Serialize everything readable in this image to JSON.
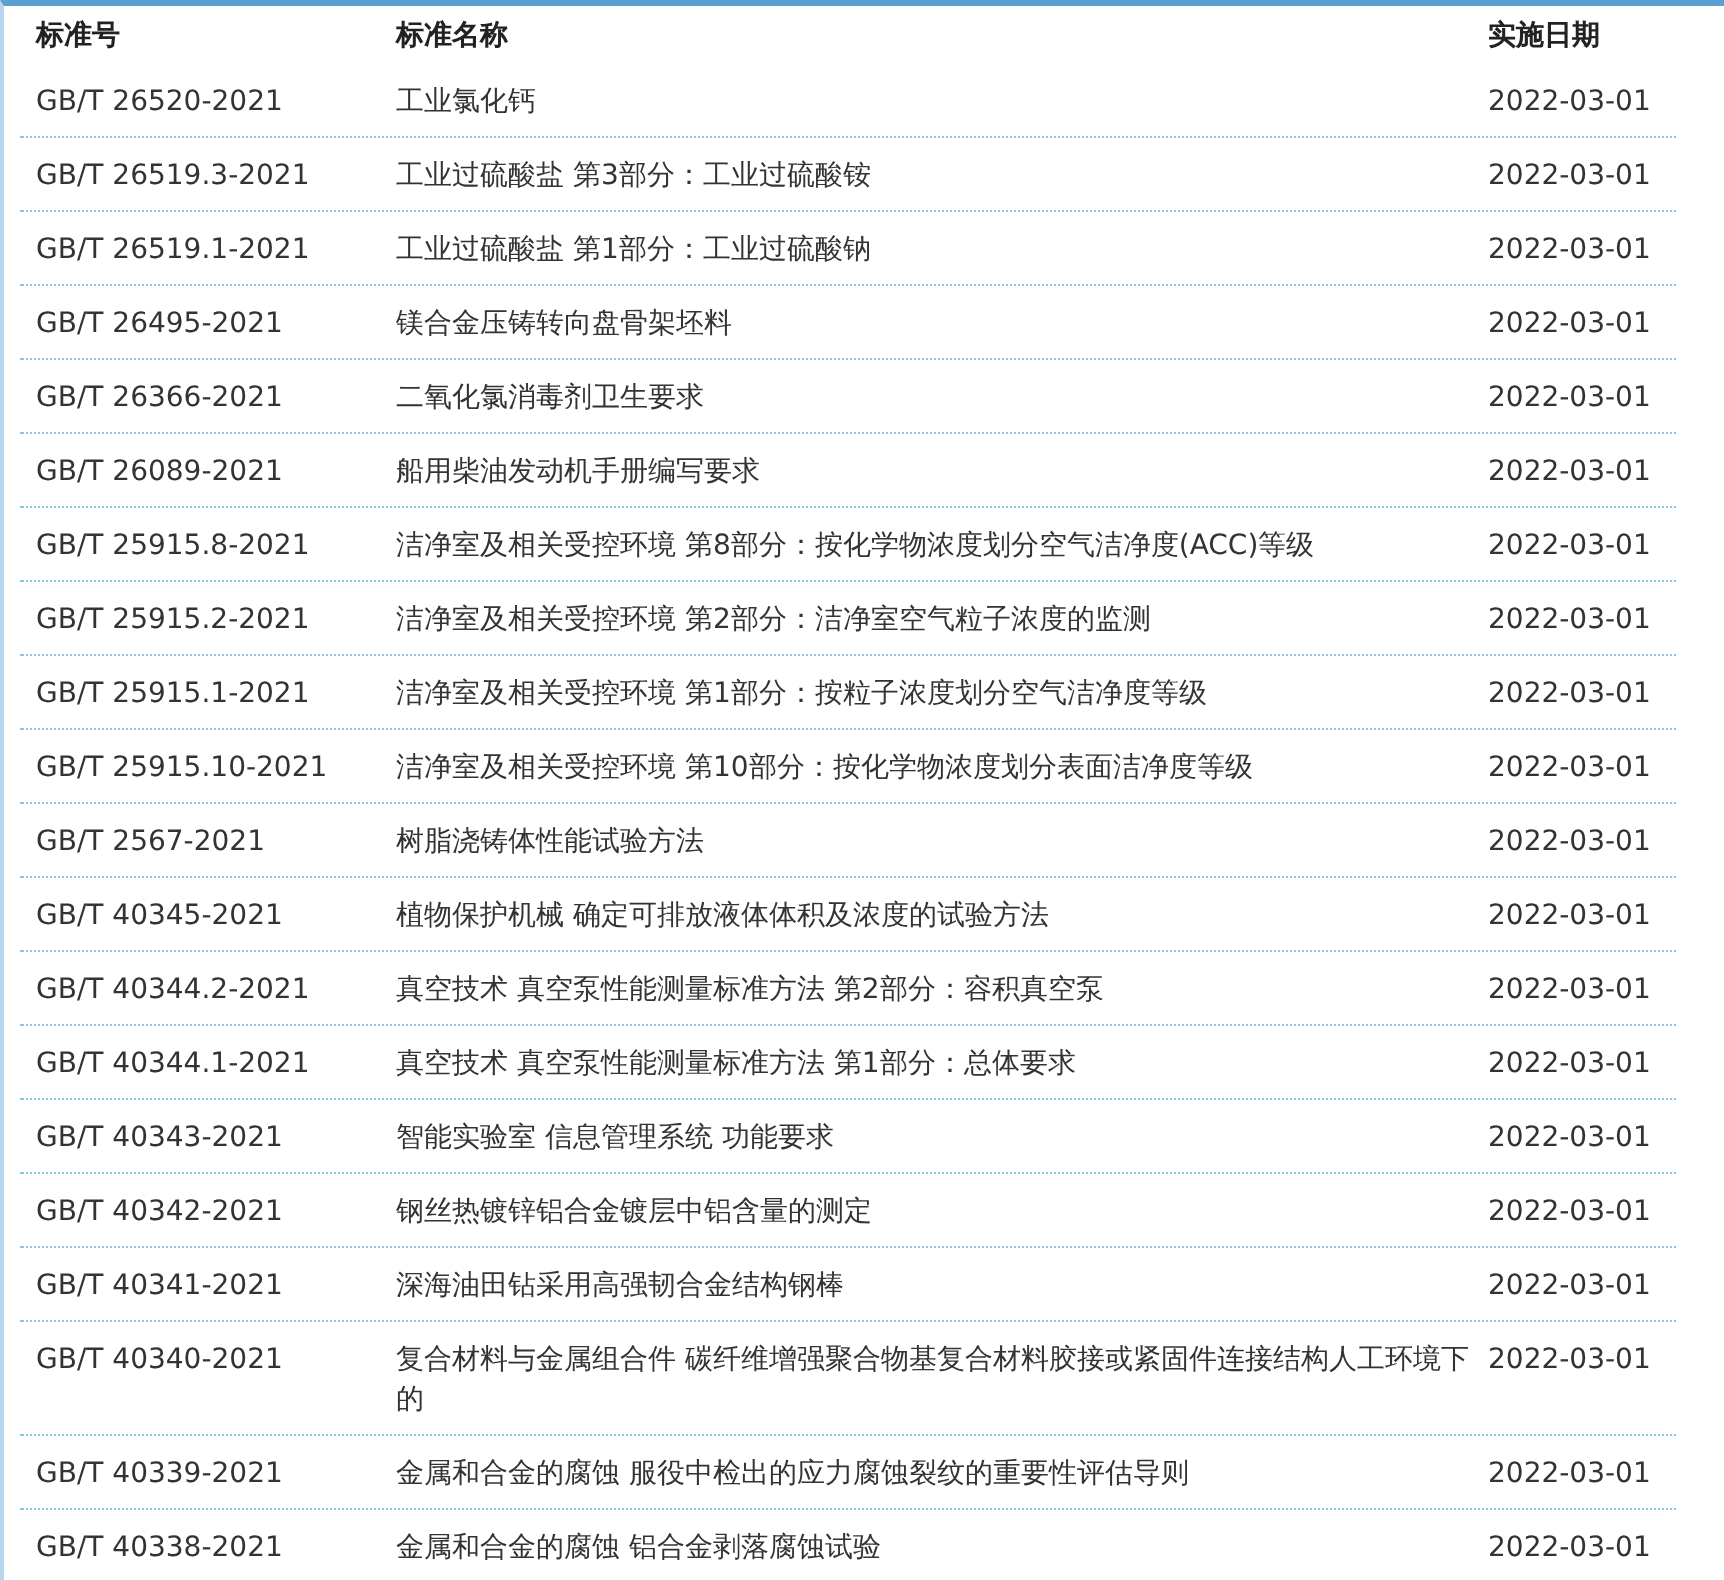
{
  "table": {
    "columns": [
      "标准号",
      "标准名称",
      "实施日期"
    ],
    "rows": [
      {
        "code": "GB/T 26520-2021",
        "name": "工业氯化钙",
        "date": "2022-03-01"
      },
      {
        "code": "GB/T 26519.3-2021",
        "name": "工业过硫酸盐 第3部分：工业过硫酸铵",
        "date": "2022-03-01"
      },
      {
        "code": "GB/T 26519.1-2021",
        "name": "工业过硫酸盐 第1部分：工业过硫酸钠",
        "date": "2022-03-01"
      },
      {
        "code": "GB/T 26495-2021",
        "name": "镁合金压铸转向盘骨架坯料",
        "date": "2022-03-01"
      },
      {
        "code": "GB/T 26366-2021",
        "name": "二氧化氯消毒剂卫生要求",
        "date": "2022-03-01"
      },
      {
        "code": "GB/T 26089-2021",
        "name": "船用柴油发动机手册编写要求",
        "date": "2022-03-01"
      },
      {
        "code": "GB/T 25915.8-2021",
        "name": "洁净室及相关受控环境 第8部分：按化学物浓度划分空气洁净度(ACC)等级",
        "date": "2022-03-01"
      },
      {
        "code": "GB/T 25915.2-2021",
        "name": "洁净室及相关受控环境 第2部分：洁净室空气粒子浓度的监测",
        "date": "2022-03-01"
      },
      {
        "code": "GB/T 25915.1-2021",
        "name": "洁净室及相关受控环境 第1部分：按粒子浓度划分空气洁净度等级",
        "date": "2022-03-01"
      },
      {
        "code": "GB/T 25915.10-2021",
        "name": "洁净室及相关受控环境 第10部分：按化学物浓度划分表面洁净度等级",
        "date": "2022-03-01"
      },
      {
        "code": "GB/T 2567-2021",
        "name": "树脂浇铸体性能试验方法",
        "date": "2022-03-01"
      },
      {
        "code": "GB/T 40345-2021",
        "name": "植物保护机械 确定可排放液体体积及浓度的试验方法",
        "date": "2022-03-01"
      },
      {
        "code": "GB/T 40344.2-2021",
        "name": "真空技术 真空泵性能测量标准方法 第2部分：容积真空泵",
        "date": "2022-03-01"
      },
      {
        "code": "GB/T 40344.1-2021",
        "name": "真空技术 真空泵性能测量标准方法 第1部分：总体要求",
        "date": "2022-03-01"
      },
      {
        "code": "GB/T 40343-2021",
        "name": "智能实验室 信息管理系统 功能要求",
        "date": "2022-03-01"
      },
      {
        "code": "GB/T 40342-2021",
        "name": "钢丝热镀锌铝合金镀层中铝含量的测定",
        "date": "2022-03-01"
      },
      {
        "code": "GB/T 40341-2021",
        "name": "深海油田钻采用高强韧合金结构钢棒",
        "date": "2022-03-01"
      },
      {
        "code": "GB/T 40340-2021",
        "name": "复合材料与金属组合件 碳纤维增强聚合物基复合材料胶接或紧固件连接结构人工环境下的",
        "date": "2022-03-01"
      },
      {
        "code": "GB/T 40339-2021",
        "name": "金属和合金的腐蚀 服役中检出的应力腐蚀裂纹的重要性评估导则",
        "date": "2022-03-01"
      },
      {
        "code": "GB/T 40338-2021",
        "name": "金属和合金的腐蚀 铝合金剥落腐蚀试验",
        "date": "2022-03-01"
      }
    ]
  }
}
